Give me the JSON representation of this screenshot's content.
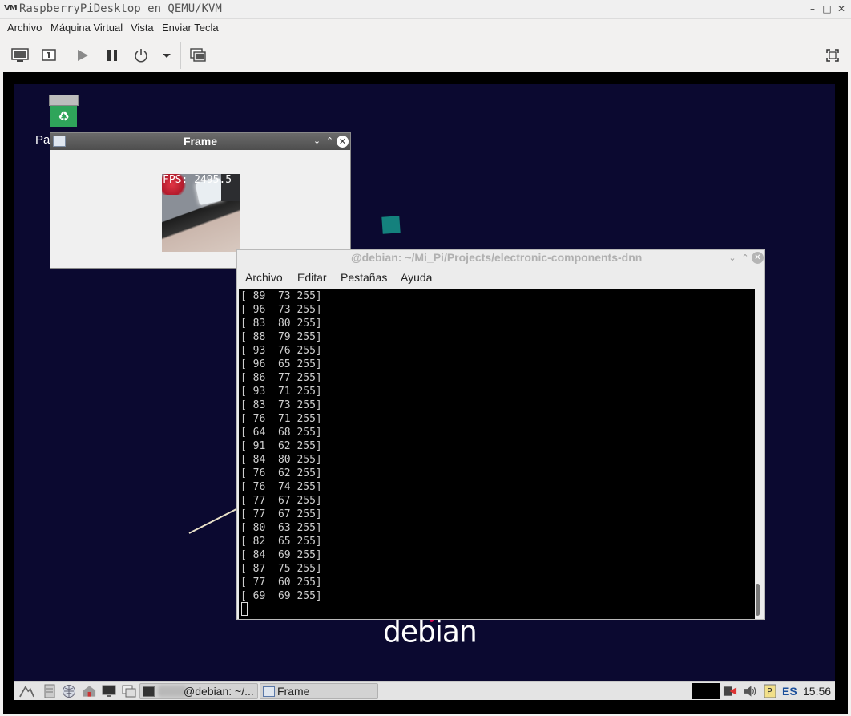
{
  "host": {
    "title": "RaspberryPiDesktop en QEMU/KVM",
    "logo_text": "VM",
    "window_controls": {
      "minimize": "–",
      "maximize": "□",
      "close": "✕"
    },
    "menus": [
      "Archivo",
      "Máquina Virtual",
      "Vista",
      "Enviar Tecla"
    ],
    "toolbar_icons": [
      "monitor-icon",
      "info-icon",
      "play-icon",
      "pause-icon",
      "power-icon",
      "dropdown-icon",
      "screenshot-icon",
      "fullscreen-icon"
    ],
    "accent_color": "#0b0930"
  },
  "desktop": {
    "trash_label": "Pa",
    "trash_symbol": "♻",
    "logo": "debian"
  },
  "frame_window": {
    "title": "Frame",
    "fps_overlay": "FPS: 2495.5"
  },
  "terminal": {
    "title": "@debian: ~/Mi_Pi/Projects/electronic-components-dnn",
    "menus": [
      "Archivo",
      "Editar",
      "Pestañas",
      "Ayuda"
    ],
    "lines": [
      "[ 89  73 255]",
      "[ 96  73 255]",
      "[ 83  80 255]",
      "[ 88  79 255]",
      "[ 93  76 255]",
      "[ 96  65 255]",
      "[ 86  77 255]",
      "[ 93  71 255]",
      "[ 83  73 255]",
      "[ 76  71 255]",
      "[ 64  68 255]",
      "[ 91  62 255]",
      "[ 84  80 255]",
      "[ 76  62 255]",
      "[ 76  74 255]",
      "[ 77  67 255]",
      "[ 77  67 255]",
      "[ 80  63 255]",
      "[ 82  65 255]",
      "[ 84  69 255]",
      "[ 87  75 255]",
      "[ 77  60 255]",
      "[ 69  69 255]"
    ]
  },
  "taskbar": {
    "tasks": [
      {
        "label": "@debian: ~/..."
      },
      {
        "label": "Frame"
      }
    ],
    "language": "ES",
    "clock": "15:56"
  }
}
